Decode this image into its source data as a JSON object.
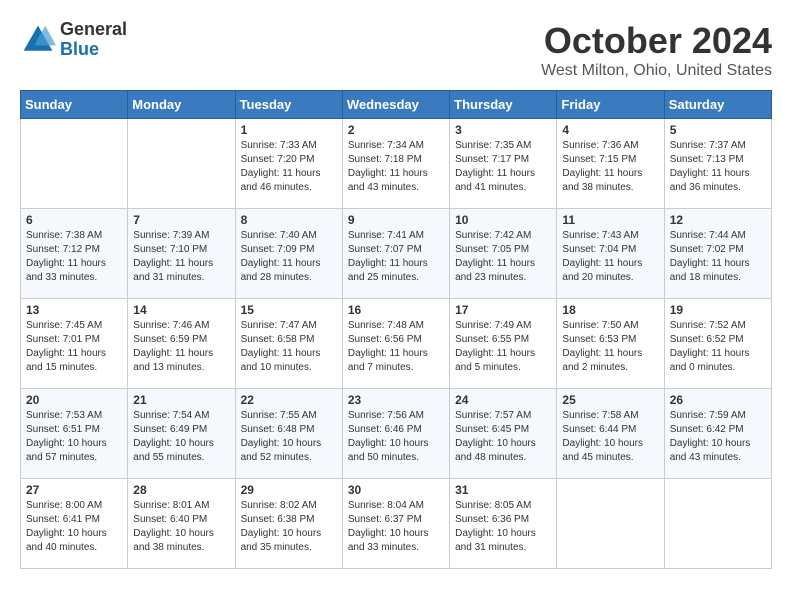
{
  "header": {
    "logo_general": "General",
    "logo_blue": "Blue",
    "month_title": "October 2024",
    "location": "West Milton, Ohio, United States"
  },
  "weekdays": [
    "Sunday",
    "Monday",
    "Tuesday",
    "Wednesday",
    "Thursday",
    "Friday",
    "Saturday"
  ],
  "weeks": [
    [
      {
        "day": "",
        "info": ""
      },
      {
        "day": "",
        "info": ""
      },
      {
        "day": "1",
        "info": "Sunrise: 7:33 AM\nSunset: 7:20 PM\nDaylight: 11 hours\nand 46 minutes."
      },
      {
        "day": "2",
        "info": "Sunrise: 7:34 AM\nSunset: 7:18 PM\nDaylight: 11 hours\nand 43 minutes."
      },
      {
        "day": "3",
        "info": "Sunrise: 7:35 AM\nSunset: 7:17 PM\nDaylight: 11 hours\nand 41 minutes."
      },
      {
        "day": "4",
        "info": "Sunrise: 7:36 AM\nSunset: 7:15 PM\nDaylight: 11 hours\nand 38 minutes."
      },
      {
        "day": "5",
        "info": "Sunrise: 7:37 AM\nSunset: 7:13 PM\nDaylight: 11 hours\nand 36 minutes."
      }
    ],
    [
      {
        "day": "6",
        "info": "Sunrise: 7:38 AM\nSunset: 7:12 PM\nDaylight: 11 hours\nand 33 minutes."
      },
      {
        "day": "7",
        "info": "Sunrise: 7:39 AM\nSunset: 7:10 PM\nDaylight: 11 hours\nand 31 minutes."
      },
      {
        "day": "8",
        "info": "Sunrise: 7:40 AM\nSunset: 7:09 PM\nDaylight: 11 hours\nand 28 minutes."
      },
      {
        "day": "9",
        "info": "Sunrise: 7:41 AM\nSunset: 7:07 PM\nDaylight: 11 hours\nand 25 minutes."
      },
      {
        "day": "10",
        "info": "Sunrise: 7:42 AM\nSunset: 7:05 PM\nDaylight: 11 hours\nand 23 minutes."
      },
      {
        "day": "11",
        "info": "Sunrise: 7:43 AM\nSunset: 7:04 PM\nDaylight: 11 hours\nand 20 minutes."
      },
      {
        "day": "12",
        "info": "Sunrise: 7:44 AM\nSunset: 7:02 PM\nDaylight: 11 hours\nand 18 minutes."
      }
    ],
    [
      {
        "day": "13",
        "info": "Sunrise: 7:45 AM\nSunset: 7:01 PM\nDaylight: 11 hours\nand 15 minutes."
      },
      {
        "day": "14",
        "info": "Sunrise: 7:46 AM\nSunset: 6:59 PM\nDaylight: 11 hours\nand 13 minutes."
      },
      {
        "day": "15",
        "info": "Sunrise: 7:47 AM\nSunset: 6:58 PM\nDaylight: 11 hours\nand 10 minutes."
      },
      {
        "day": "16",
        "info": "Sunrise: 7:48 AM\nSunset: 6:56 PM\nDaylight: 11 hours\nand 7 minutes."
      },
      {
        "day": "17",
        "info": "Sunrise: 7:49 AM\nSunset: 6:55 PM\nDaylight: 11 hours\nand 5 minutes."
      },
      {
        "day": "18",
        "info": "Sunrise: 7:50 AM\nSunset: 6:53 PM\nDaylight: 11 hours\nand 2 minutes."
      },
      {
        "day": "19",
        "info": "Sunrise: 7:52 AM\nSunset: 6:52 PM\nDaylight: 11 hours\nand 0 minutes."
      }
    ],
    [
      {
        "day": "20",
        "info": "Sunrise: 7:53 AM\nSunset: 6:51 PM\nDaylight: 10 hours\nand 57 minutes."
      },
      {
        "day": "21",
        "info": "Sunrise: 7:54 AM\nSunset: 6:49 PM\nDaylight: 10 hours\nand 55 minutes."
      },
      {
        "day": "22",
        "info": "Sunrise: 7:55 AM\nSunset: 6:48 PM\nDaylight: 10 hours\nand 52 minutes."
      },
      {
        "day": "23",
        "info": "Sunrise: 7:56 AM\nSunset: 6:46 PM\nDaylight: 10 hours\nand 50 minutes."
      },
      {
        "day": "24",
        "info": "Sunrise: 7:57 AM\nSunset: 6:45 PM\nDaylight: 10 hours\nand 48 minutes."
      },
      {
        "day": "25",
        "info": "Sunrise: 7:58 AM\nSunset: 6:44 PM\nDaylight: 10 hours\nand 45 minutes."
      },
      {
        "day": "26",
        "info": "Sunrise: 7:59 AM\nSunset: 6:42 PM\nDaylight: 10 hours\nand 43 minutes."
      }
    ],
    [
      {
        "day": "27",
        "info": "Sunrise: 8:00 AM\nSunset: 6:41 PM\nDaylight: 10 hours\nand 40 minutes."
      },
      {
        "day": "28",
        "info": "Sunrise: 8:01 AM\nSunset: 6:40 PM\nDaylight: 10 hours\nand 38 minutes."
      },
      {
        "day": "29",
        "info": "Sunrise: 8:02 AM\nSunset: 6:38 PM\nDaylight: 10 hours\nand 35 minutes."
      },
      {
        "day": "30",
        "info": "Sunrise: 8:04 AM\nSunset: 6:37 PM\nDaylight: 10 hours\nand 33 minutes."
      },
      {
        "day": "31",
        "info": "Sunrise: 8:05 AM\nSunset: 6:36 PM\nDaylight: 10 hours\nand 31 minutes."
      },
      {
        "day": "",
        "info": ""
      },
      {
        "day": "",
        "info": ""
      }
    ]
  ]
}
